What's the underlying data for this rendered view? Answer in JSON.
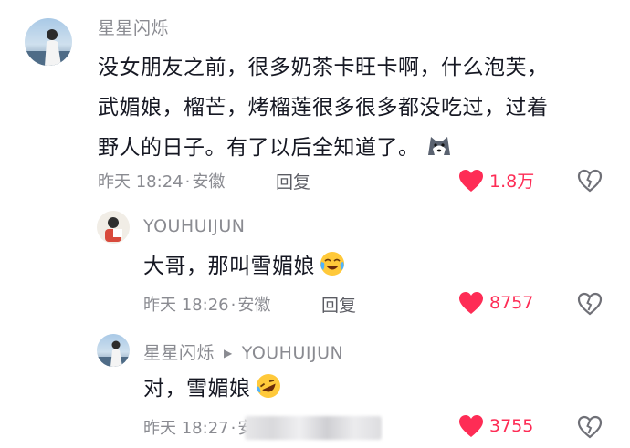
{
  "comments": [
    {
      "username": "星星闪烁",
      "text_lines": [
        "没女朋友之前，很多奶茶卡旺卡啊，什么泡芙，",
        "武媚娘，榴芒，烤榴莲很多很多都没吃过，过着",
        "野人的日子。有了以后全知道了。"
      ],
      "trailing_emoji": "husky-emoji",
      "time": "昨天 18:24",
      "location": "安徽",
      "reply_label": "回复",
      "likes": "1.8万"
    },
    {
      "username": "YOUHUIJUN",
      "text": "大哥，那叫雪媚娘",
      "trailing_emoji": "crying-laughing-emoji",
      "time": "昨天 18:26",
      "location": "安徽",
      "reply_label": "回复",
      "likes": "8757"
    },
    {
      "username": "星星闪烁",
      "reply_to": "YOUHUIJUN",
      "text": "对，雪媚娘",
      "trailing_emoji": "rolling-laughing-emoji",
      "time": "昨天 18:27",
      "location_partial": "安",
      "likes": "3755"
    }
  ],
  "colors": {
    "like_red": "#fe2c55",
    "meta_gray": "#8a8b91",
    "text": "#161823"
  }
}
